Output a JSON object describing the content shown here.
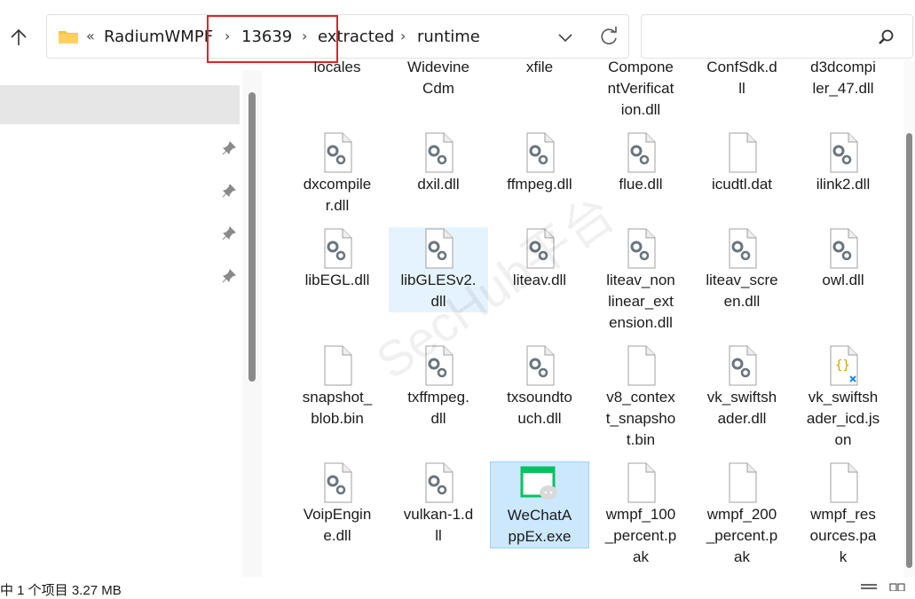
{
  "breadcrumb": {
    "overflow": "«",
    "items": [
      "RadiumWMPF",
      "13639",
      "extracted",
      "runtime"
    ],
    "separator": "›"
  },
  "highlight_color": "#e02424",
  "selection_color": "#cce8ff",
  "watermark": "SecHub平台",
  "files": [
    {
      "name": "locales",
      "icon": "folder-icon"
    },
    {
      "name": "WidevineCdm",
      "icon": "folder-icon"
    },
    {
      "name": "xfile",
      "icon": "folder-icon"
    },
    {
      "name": "ComponentVerification.dll",
      "icon": "dll-gear-icon"
    },
    {
      "name": "ConfSdk.dll",
      "icon": "dll-gear-icon"
    },
    {
      "name": "d3dcompiler_47.dll",
      "icon": "dll-gear-icon"
    },
    {
      "name": "dxcompiler.dll",
      "icon": "dll-gear-icon"
    },
    {
      "name": "dxil.dll",
      "icon": "dll-gear-icon"
    },
    {
      "name": "ffmpeg.dll",
      "icon": "dll-gear-icon"
    },
    {
      "name": "flue.dll",
      "icon": "dll-gear-icon"
    },
    {
      "name": "icudtl.dat",
      "icon": "blank-file-icon"
    },
    {
      "name": "ilink2.dll",
      "icon": "dll-gear-icon"
    },
    {
      "name": "libEGL.dll",
      "icon": "dll-gear-icon"
    },
    {
      "name": "libGLESv2.dll",
      "icon": "dll-gear-icon"
    },
    {
      "name": "liteav.dll",
      "icon": "dll-gear-icon"
    },
    {
      "name": "liteav_nonlinear_extension.dll",
      "icon": "dll-gear-icon"
    },
    {
      "name": "liteav_screen.dll",
      "icon": "dll-gear-icon"
    },
    {
      "name": "owl.dll",
      "icon": "dll-gear-icon"
    },
    {
      "name": "snapshot_blob.bin",
      "icon": "blank-file-icon"
    },
    {
      "name": "txffmpeg.dll",
      "icon": "dll-gear-icon"
    },
    {
      "name": "txsoundtouch.dll",
      "icon": "dll-gear-icon"
    },
    {
      "name": "v8_context_snapshot.bin",
      "icon": "blank-file-icon"
    },
    {
      "name": "vk_swiftshader.dll",
      "icon": "dll-gear-icon"
    },
    {
      "name": "vk_swiftshader_icd.json",
      "icon": "json-file-icon"
    },
    {
      "name": "VoipEngine.dll",
      "icon": "dll-gear-icon"
    },
    {
      "name": "vulkan-1.dll",
      "icon": "dll-gear-icon"
    },
    {
      "name": "WeChatAppEx.exe",
      "icon": "wechat-app-icon",
      "selected": true
    },
    {
      "name": "wmpf_100_percent.pak",
      "icon": "blank-file-icon"
    },
    {
      "name": "wmpf_200_percent.pak",
      "icon": "blank-file-icon"
    },
    {
      "name": "wmpf_resources.pak",
      "icon": "blank-file-icon"
    }
  ],
  "file_labels_wrapped": [
    "locales",
    "Widevine\nCdm",
    "xfile",
    "Compone\nntVerificat\nion.dll",
    "ConfSdk.d\nll",
    "d3dcompi\nler_47.dll",
    "dxcompile\nr.dll",
    "dxil.dll",
    "ffmpeg.dll",
    "flue.dll",
    "icudtl.dat",
    "ilink2.dll",
    "libEGL.dll",
    "libGLESv2.\ndll",
    "liteav.dll",
    "liteav_non\nlinear_ext\nension.dll",
    "liteav_scre\nen.dll",
    "owl.dll",
    "snapshot_\nblob.bin",
    "txffmpeg.\ndll",
    "txsoundto\nuch.dll",
    "v8_contex\nt_snapsho\nt.bin",
    "vk_swiftsh\nader.dll",
    "vk_swiftsh\nader_icd.js\non",
    "VoipEngin\ne.dll",
    "vulkan-1.d\nll",
    "WeChatA\nppEx.exe",
    "wmpf_100\n_percent.p\nak",
    "wmpf_200\n_percent.p\nak",
    "wmpf_res\nources.pa\nk"
  ],
  "status": {
    "text": "中 1 个项目 3.27 MB"
  }
}
